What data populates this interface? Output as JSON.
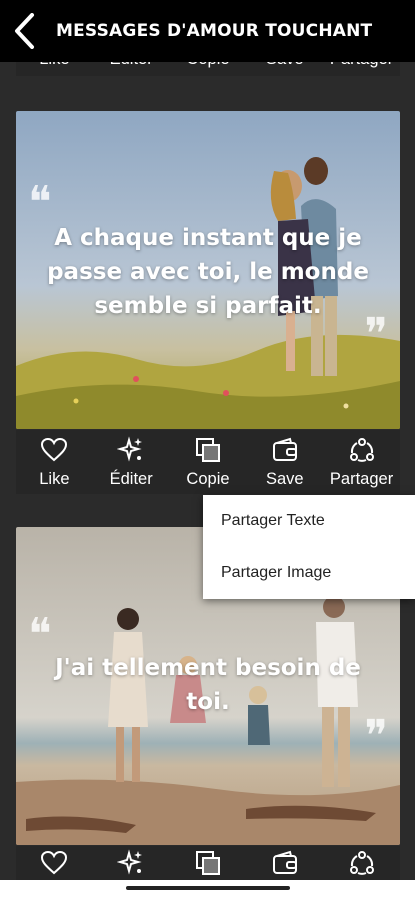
{
  "header": {
    "title": "MESSAGES D'AMOUR TOUCHANT",
    "back_icon": "chevron-left-icon"
  },
  "top_actions": [
    "Like",
    "Éditer",
    "Copie",
    "Save",
    "Partager"
  ],
  "cards": [
    {
      "quote": "A chaque instant que je passe avec toi, le monde semble si parfait.",
      "actions": [
        "Like",
        "Éditer",
        "Copie",
        "Save",
        "Partager"
      ]
    },
    {
      "quote": "J'ai tellement besoin de toi.",
      "actions": [
        "",
        "",
        "",
        "",
        ""
      ]
    }
  ],
  "share_menu": {
    "items": [
      "Partager Texte",
      "Partager Image"
    ]
  },
  "icons": [
    "heart-icon",
    "sparkle-icon",
    "copy-icon",
    "wallet-icon",
    "share-icon"
  ],
  "colors": {
    "header_bg": "#000000",
    "page_bg": "#2b2b2b",
    "menu_bg": "#ffffff"
  }
}
